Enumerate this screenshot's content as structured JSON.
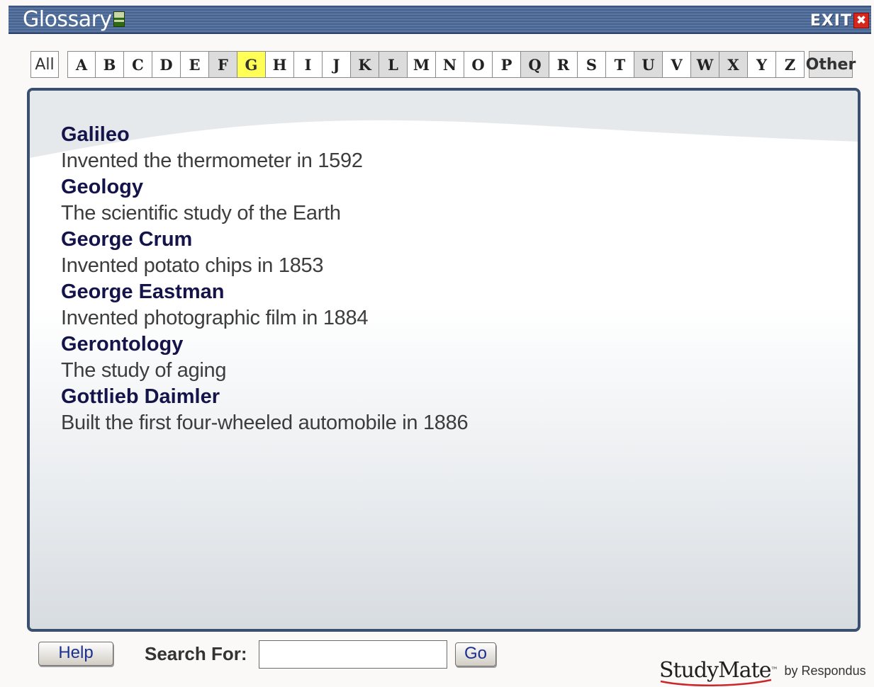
{
  "window": {
    "title": "Glossary",
    "exit_label": "EXIT",
    "exit_x": "✖"
  },
  "letters": {
    "all": "All",
    "other": "Other",
    "items": [
      {
        "letter": "A",
        "has_entries": false,
        "active": false
      },
      {
        "letter": "B",
        "has_entries": false,
        "active": false
      },
      {
        "letter": "C",
        "has_entries": false,
        "active": false
      },
      {
        "letter": "D",
        "has_entries": false,
        "active": false
      },
      {
        "letter": "E",
        "has_entries": false,
        "active": false
      },
      {
        "letter": "F",
        "has_entries": true,
        "active": false
      },
      {
        "letter": "G",
        "has_entries": true,
        "active": true
      },
      {
        "letter": "H",
        "has_entries": false,
        "active": false
      },
      {
        "letter": "I",
        "has_entries": false,
        "active": false
      },
      {
        "letter": "J",
        "has_entries": false,
        "active": false
      },
      {
        "letter": "K",
        "has_entries": true,
        "active": false
      },
      {
        "letter": "L",
        "has_entries": true,
        "active": false
      },
      {
        "letter": "M",
        "has_entries": false,
        "active": false
      },
      {
        "letter": "N",
        "has_entries": false,
        "active": false
      },
      {
        "letter": "O",
        "has_entries": false,
        "active": false
      },
      {
        "letter": "P",
        "has_entries": false,
        "active": false
      },
      {
        "letter": "Q",
        "has_entries": true,
        "active": false
      },
      {
        "letter": "R",
        "has_entries": false,
        "active": false
      },
      {
        "letter": "S",
        "has_entries": false,
        "active": false
      },
      {
        "letter": "T",
        "has_entries": false,
        "active": false
      },
      {
        "letter": "U",
        "has_entries": true,
        "active": false
      },
      {
        "letter": "V",
        "has_entries": false,
        "active": false
      },
      {
        "letter": "W",
        "has_entries": true,
        "active": false
      },
      {
        "letter": "X",
        "has_entries": true,
        "active": false
      },
      {
        "letter": "Y",
        "has_entries": false,
        "active": false
      },
      {
        "letter": "Z",
        "has_entries": false,
        "active": false
      }
    ]
  },
  "entries": [
    {
      "term": "Galileo",
      "definition": "Invented the thermometer in 1592"
    },
    {
      "term": "Geology",
      "definition": "The scientific study of the Earth"
    },
    {
      "term": "George Crum",
      "definition": "Invented potato chips in 1853"
    },
    {
      "term": "George Eastman",
      "definition": "Invented photographic film in 1884"
    },
    {
      "term": "Gerontology",
      "definition": "The study of aging"
    },
    {
      "term": "Gottlieb Daimler",
      "definition": "Built the first four-wheeled automobile in 1886"
    }
  ],
  "footer": {
    "help_label": "Help",
    "search_label": "Search For:",
    "search_value": "",
    "go_label": "Go",
    "brand_name": "StudyMate",
    "brand_tm": "™",
    "brand_by": "by Respondus"
  },
  "colors": {
    "titlebar": "#4e6b97",
    "active_letter": "#ffff55",
    "has_entries_letter": "#dcdcdc",
    "term_text": "#14144a",
    "panel_border": "#3a506e",
    "exit_x": "#d9261c"
  }
}
